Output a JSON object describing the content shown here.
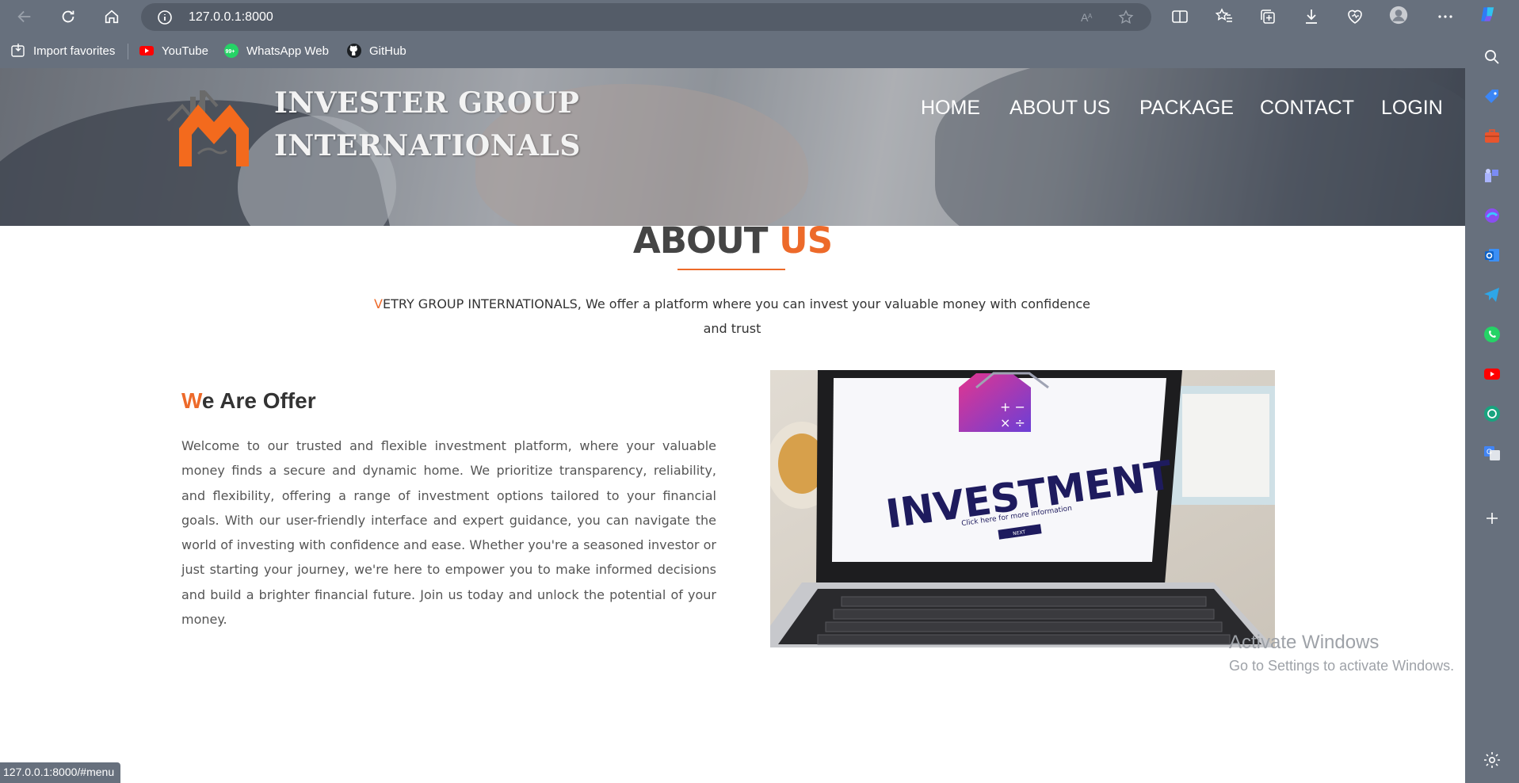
{
  "browser": {
    "url": "127.0.0.1:8000",
    "status_url": "127.0.0.1:8000/#menu",
    "bookmarks": [
      {
        "label": "Import favorites",
        "icon": "import-favorites-icon"
      },
      {
        "label": "YouTube",
        "icon": "youtube-icon"
      },
      {
        "label": "WhatsApp Web",
        "icon": "whatsapp-icon"
      },
      {
        "label": "GitHub",
        "icon": "github-icon"
      }
    ],
    "whatsapp_badge": "99+"
  },
  "site": {
    "brand_line1": "INVESTER GROUP",
    "brand_line2": "INTERNATIONALS",
    "menu": [
      "HOME",
      "ABOUT US",
      "PACKAGE",
      "CONTACT",
      "LOGIN"
    ]
  },
  "about": {
    "title_main": "ABOUT ",
    "title_accent": "US",
    "intro_first": "V",
    "intro_rest": "ETRY GROUP INTERNATIONALS, We offer a platform where you can invest your valuable money with confidence and trust",
    "offer_title_first": "W",
    "offer_title_rest": "e Are Offer",
    "offer_body": "Welcome to our trusted and flexible investment platform, where your valuable money finds a secure and dynamic home. We prioritize transparency, reliability, and flexibility, offering a range of investment options tailored to your financial goals. With our user-friendly interface and expert guidance, you can navigate the world of investing with confidence and ease. Whether you're a seasoned investor or just starting your journey, we're here to empower you to make informed decisions and build a brighter financial future. Join us today and unlock the potential of your money."
  },
  "image": {
    "screen_word": "INVESTMENT",
    "screen_caption": "Click here for more information",
    "screen_button": "NEXT"
  },
  "watermark": {
    "line1": "Activate Windows",
    "line2": "Go to Settings to activate Windows."
  },
  "colors": {
    "accent": "#ed6a2a",
    "chrome": "#67707d"
  }
}
